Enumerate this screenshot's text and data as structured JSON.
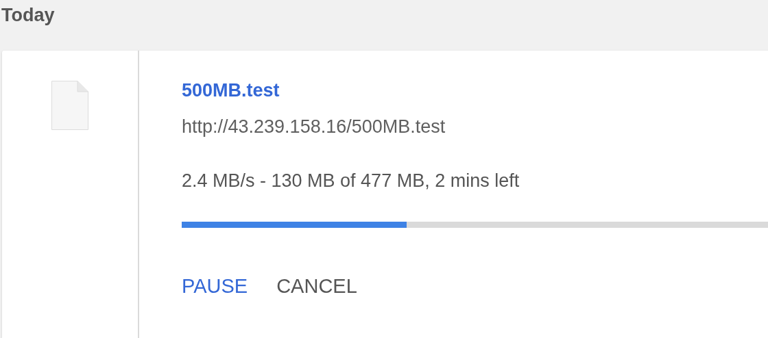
{
  "section": {
    "title": "Today"
  },
  "download": {
    "file_name": "500MB.test",
    "url": "http://43.239.158.16/500MB.test",
    "status": "2.4 MB/s - 130 MB of 477 MB, 2 mins left",
    "progress": {
      "level": 0.2725
    },
    "buttons": [
      {
        "label": "PAUSE",
        "kind": "primary"
      },
      {
        "label": "CANCEL",
        "kind": "secondary"
      }
    ]
  }
}
